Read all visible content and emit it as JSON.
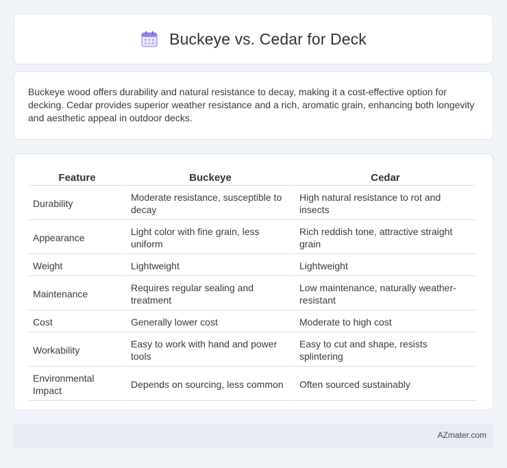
{
  "header": {
    "title": "Buckeye vs. Cedar for Deck",
    "icon": "calendar-icon"
  },
  "description": "Buckeye wood offers durability and natural resistance to decay, making it a cost-effective option for decking. Cedar provides superior weather resistance and a rich, aromatic grain, enhancing both longevity and aesthetic appeal in outdoor decks.",
  "table": {
    "headers": [
      "Feature",
      "Buckeye",
      "Cedar"
    ],
    "rows": [
      [
        "Durability",
        "Moderate resistance, susceptible to decay",
        "High natural resistance to rot and insects"
      ],
      [
        "Appearance",
        "Light color with fine grain, less uniform",
        "Rich reddish tone, attractive straight grain"
      ],
      [
        "Weight",
        "Lightweight",
        "Lightweight"
      ],
      [
        "Maintenance",
        "Requires regular sealing and treatment",
        "Low maintenance, naturally weather-resistant"
      ],
      [
        "Cost",
        "Generally lower cost",
        "Moderate to high cost"
      ],
      [
        "Workability",
        "Easy to work with hand and power tools",
        "Easy to cut and shape, resists splintering"
      ],
      [
        "Environmental Impact",
        "Depends on sourcing, less common",
        "Often sourced sustainably"
      ]
    ]
  },
  "footer": {
    "brand": "AZmater.com"
  }
}
